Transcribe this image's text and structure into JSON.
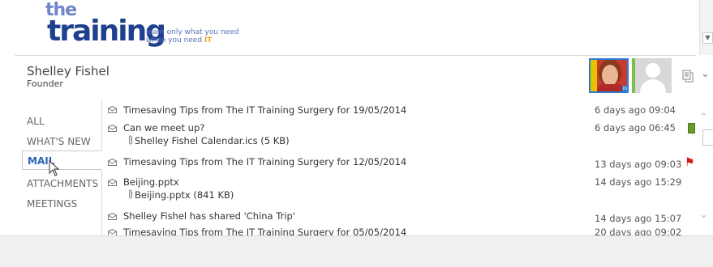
{
  "logo": {
    "line1": "the",
    "line2": "training",
    "tagline_1": "learn only what you need",
    "tagline_2_prefix": "when you need ",
    "tagline_2_it": "IT"
  },
  "person": {
    "name": "Shelley Fishel",
    "title": "Founder"
  },
  "nav": {
    "items": [
      {
        "label": "ALL"
      },
      {
        "label": "WHAT'S NEW"
      },
      {
        "label": "MAIL"
      },
      {
        "label": "ATTACHMENTS"
      },
      {
        "label": "MEETINGS"
      }
    ],
    "selected": "MAIL"
  },
  "mail": {
    "items": [
      {
        "subject": "Timesaving Tips from The IT Training Surgery for 19/05/2014",
        "date": "6 days ago 09:04"
      },
      {
        "subject": "Can we meet up?",
        "attachment": "Shelley Fishel Calendar.ics (5 KB)",
        "date": "6 days ago 06:45",
        "tag": "green"
      },
      {
        "subject": "Timesaving Tips from The IT Training Surgery for 12/05/2014",
        "date": "13 days ago 09:03",
        "flag": "red"
      },
      {
        "subject": "Beijing.pptx",
        "attachment": "Beijing.pptx (841 KB)",
        "date": "14 days ago 15:29"
      },
      {
        "subject": "Shelley Fishel has shared 'China Trip'",
        "date": "14 days ago 15:07"
      },
      {
        "subject": "Timesaving Tips from The IT Training Surgery for 05/05/2014",
        "date": "20 days ago 09:02"
      }
    ]
  },
  "colors": {
    "accent": "#2b62b3",
    "flag": "#d11a1a",
    "tag_green": "#6a9a2b",
    "presence": "#7ac143"
  }
}
